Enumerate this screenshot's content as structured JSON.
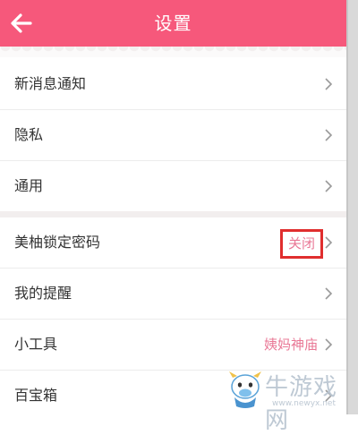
{
  "header": {
    "title": "设置",
    "back_icon": "back-arrow-icon",
    "color": "#f6587b"
  },
  "section1": [
    {
      "label": "新消息通知"
    },
    {
      "label": "隐私"
    },
    {
      "label": "通用"
    }
  ],
  "section2": [
    {
      "label": "美柚锁定密码",
      "value": "关闭"
    },
    {
      "label": "我的提醒"
    },
    {
      "label": "小工具",
      "value": "姨妈神庙"
    },
    {
      "label": "百宝箱"
    }
  ],
  "chevron_icon": "chevron-right-icon",
  "highlight_color": "#e02e2e",
  "value_color": "#e97896",
  "watermark": {
    "text": "牛游戏网",
    "url": "www.newyx.net"
  }
}
